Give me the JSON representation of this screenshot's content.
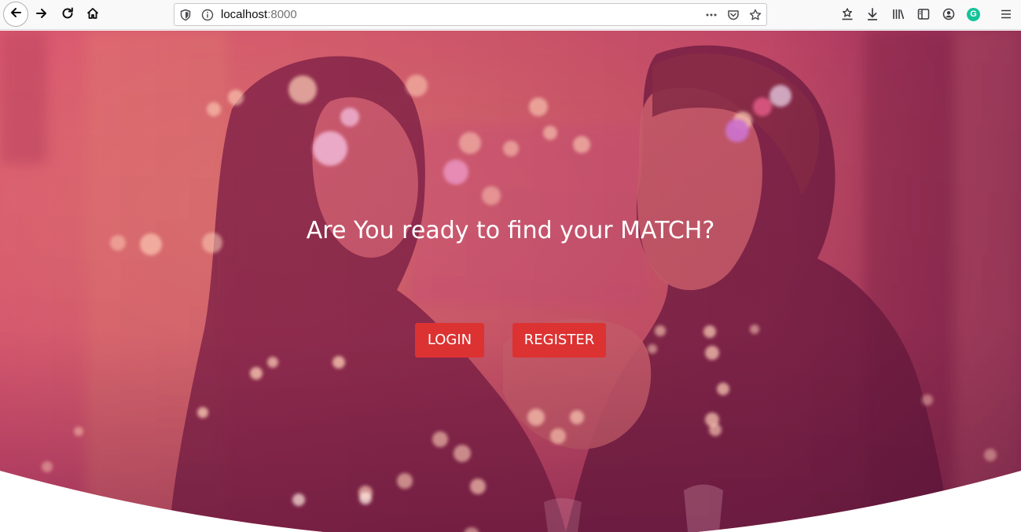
{
  "browser": {
    "url_host": "localhost",
    "url_port": ":8000",
    "extension_badge": "G"
  },
  "hero": {
    "title": "Are You ready to find your MATCH?",
    "login_label": "LOGIN",
    "register_label": "REGISTER"
  },
  "colors": {
    "overlay": "#d23c6e",
    "button": "#dc3232",
    "text": "#ffffff"
  },
  "icons": {
    "back": "back-arrow-icon",
    "forward": "forward-arrow-icon",
    "reload": "reload-icon",
    "home": "home-icon",
    "tracking": "shield-icon",
    "info": "info-icon",
    "page_actions": "ellipsis-icon",
    "pocket": "pocket-icon",
    "bookmark": "star-icon",
    "bookmarks_toolbar": "bookmark-tray-icon",
    "downloads": "download-icon",
    "library": "library-icon",
    "sidebar": "sidebar-icon",
    "account": "account-icon",
    "menu": "hamburger-menu-icon"
  }
}
